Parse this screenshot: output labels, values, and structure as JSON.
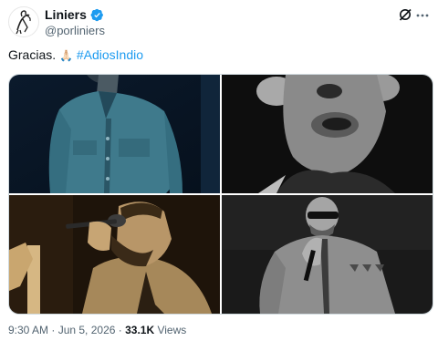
{
  "tweet": {
    "display_name": "Liniers",
    "handle": "@porliniers",
    "text": "Gracias.",
    "emoji": "🙏🏻",
    "hashtag": "#AdiosIndio",
    "time": "9:30 AM",
    "date": "Jun 5, 2026",
    "separator": " · ",
    "views_count": "33.1K",
    "views_label": " Views"
  },
  "icons": {
    "verified": "verified-badge-icon",
    "grok": "grok-icon",
    "more": "more-options-icon"
  },
  "colors": {
    "accent": "#1d9bf0",
    "text": "#0f1419",
    "secondary": "#536471"
  }
}
